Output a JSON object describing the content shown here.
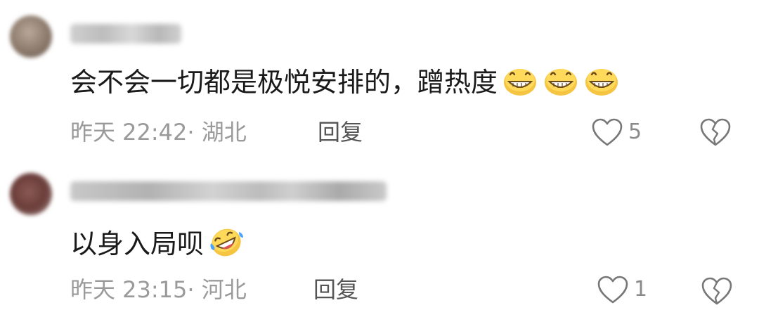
{
  "comments": [
    {
      "text": "会不会一切都是极悦安排的，蹭热度",
      "emojis": [
        "grinning-face",
        "grinning-face",
        "grinning-face"
      ],
      "time": "昨天 22:42",
      "location": "· 湖北",
      "reply_label": "回复",
      "likes": "5"
    },
    {
      "text": "以身入局呗",
      "emojis": [
        "rolling-on-floor-laughing"
      ],
      "time": "昨天 23:15",
      "location": "· 河北",
      "reply_label": "回复",
      "likes": "1"
    }
  ],
  "colors": {
    "text": "#1a1a1a",
    "meta": "#9a9a9a",
    "reply": "#555555",
    "icon": "#777777",
    "emoji": "#f5c542"
  }
}
